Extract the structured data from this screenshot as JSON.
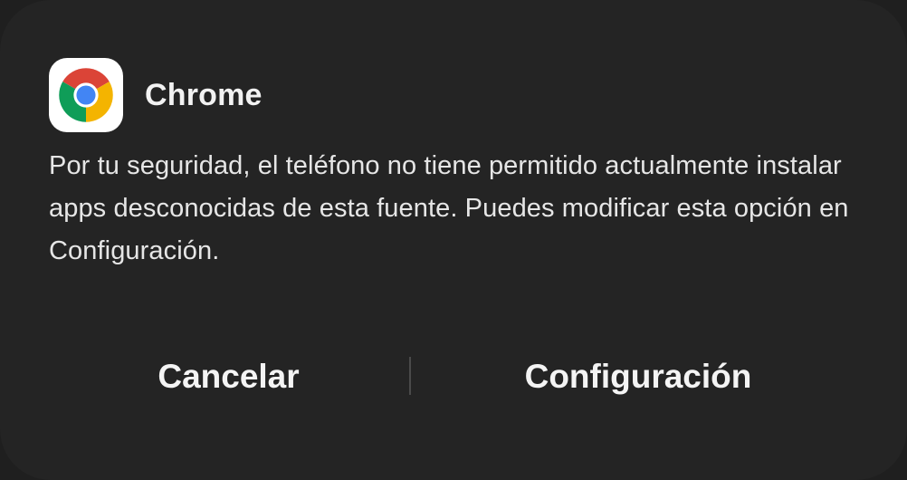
{
  "dialog": {
    "app_name": "Chrome",
    "app_icon": "chrome-icon",
    "message": "Por tu seguridad, el teléfono no tiene permitido actualmente instalar apps desconocidas de esta fuente. Puedes modificar esta opción en Configuración.",
    "cancel_label": "Cancelar",
    "settings_label": "Configuración"
  },
  "colors": {
    "dialog_background": "#242424",
    "text_primary": "#f2f2f2",
    "divider": "#4a4a4a"
  }
}
